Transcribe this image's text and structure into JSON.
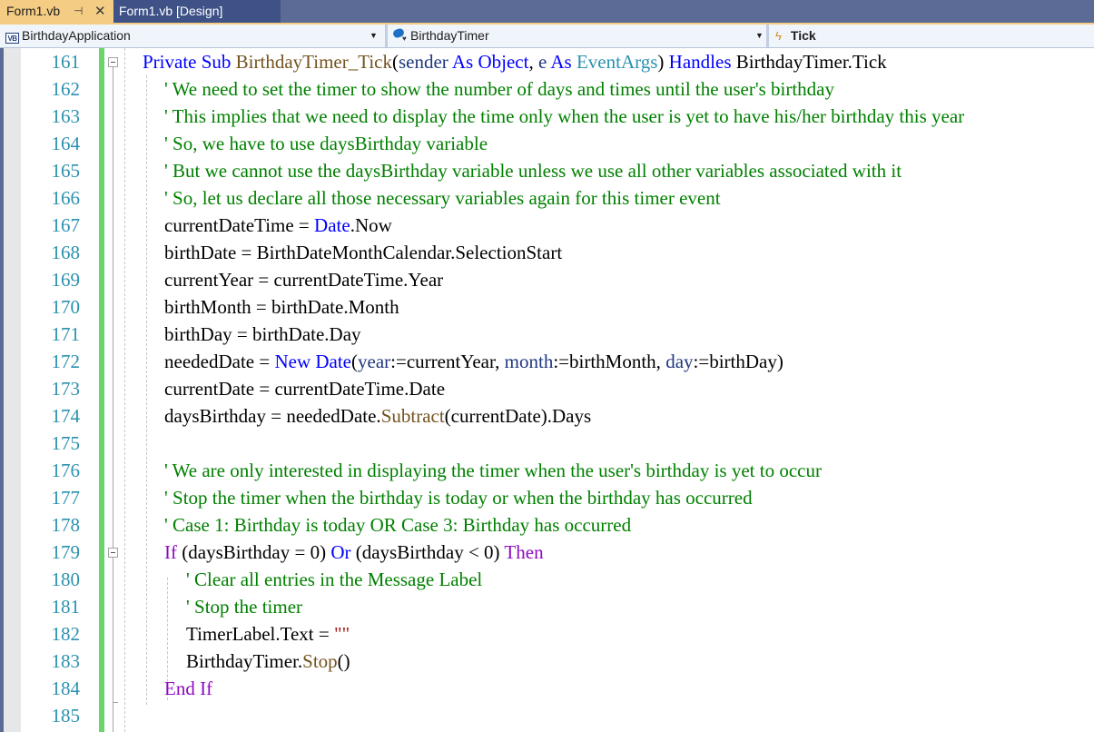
{
  "tabs": [
    {
      "label": "Form1.vb",
      "active": true,
      "pin_icon": "pin-icon",
      "close_icon": "close-icon"
    },
    {
      "label": "Form1.vb [Design]",
      "active": false
    }
  ],
  "navbar": {
    "project": {
      "icon": "vb-project-icon",
      "icon_text": "VB",
      "label": "BirthdayApplication"
    },
    "object": {
      "icon": "timer-component-icon",
      "label": "BirthdayTimer"
    },
    "event": {
      "icon": "lightning-event-icon",
      "label": "Tick"
    }
  },
  "colors": {
    "keyword": "#0000ff",
    "control_keyword": "#8f08c4",
    "comment": "#008000",
    "method": "#74531f",
    "type": "#2b91af",
    "parameter": "#1f377f",
    "string": "#a31515",
    "line_number": "#2b91af",
    "change_bar": "#6bd46b",
    "active_tab": "#f5cc84",
    "tab_strip": "#5c6b95"
  },
  "editor": {
    "line_numbers": [
      "161",
      "162",
      "163",
      "164",
      "165",
      "166",
      "167",
      "168",
      "169",
      "170",
      "171",
      "172",
      "173",
      "174",
      "175",
      "176",
      "177",
      "178",
      "179",
      "180",
      "181",
      "182",
      "183",
      "184",
      "185"
    ],
    "lines": [
      {
        "indent": 0,
        "tokens": [
          [
            "kw",
            "Private"
          ],
          [
            "",
            " "
          ],
          [
            "kw",
            "Sub"
          ],
          [
            "",
            " "
          ],
          [
            "fn",
            "BirthdayTimer_Tick"
          ],
          [
            "",
            "("
          ],
          [
            "pm",
            "sender"
          ],
          [
            "",
            " "
          ],
          [
            "kw",
            "As"
          ],
          [
            "",
            " "
          ],
          [
            "kw",
            "Object"
          ],
          [
            "",
            ", "
          ],
          [
            "pm",
            "e"
          ],
          [
            "",
            " "
          ],
          [
            "kw",
            "As"
          ],
          [
            "",
            " "
          ],
          [
            "ty",
            "EventArgs"
          ],
          [
            "",
            ") "
          ],
          [
            "kw",
            "Handles"
          ],
          [
            "",
            " BirthdayTimer.Tick"
          ]
        ]
      },
      {
        "indent": 1,
        "tokens": [
          [
            "cm",
            "' We need to set the timer to show the number of days and times until the user's birthday"
          ]
        ]
      },
      {
        "indent": 1,
        "tokens": [
          [
            "cm",
            "' This implies that we need to display the time only when the user is yet to have his/her birthday this year"
          ]
        ]
      },
      {
        "indent": 1,
        "tokens": [
          [
            "cm",
            "' So, we have to use daysBirthday variable"
          ]
        ]
      },
      {
        "indent": 1,
        "tokens": [
          [
            "cm",
            "' But we cannot use the daysBirthday variable unless we use all other variables associated with it"
          ]
        ]
      },
      {
        "indent": 1,
        "tokens": [
          [
            "cm",
            "' So, let us declare all those necessary variables again for this timer event"
          ]
        ]
      },
      {
        "indent": 1,
        "tokens": [
          [
            "",
            "currentDateTime = "
          ],
          [
            "kw",
            "Date"
          ],
          [
            "",
            ".Now"
          ]
        ]
      },
      {
        "indent": 1,
        "tokens": [
          [
            "",
            "birthDate = BirthDateMonthCalendar.SelectionStart"
          ]
        ]
      },
      {
        "indent": 1,
        "tokens": [
          [
            "",
            "currentYear = currentDateTime.Year"
          ]
        ]
      },
      {
        "indent": 1,
        "tokens": [
          [
            "",
            "birthMonth = birthDate.Month"
          ]
        ]
      },
      {
        "indent": 1,
        "tokens": [
          [
            "",
            "birthDay = birthDate.Day"
          ]
        ]
      },
      {
        "indent": 1,
        "tokens": [
          [
            "",
            "neededDate = "
          ],
          [
            "kw",
            "New"
          ],
          [
            "",
            " "
          ],
          [
            "kw",
            "Date"
          ],
          [
            "",
            "("
          ],
          [
            "pm",
            "year"
          ],
          [
            "",
            ":=currentYear, "
          ],
          [
            "pm",
            "month"
          ],
          [
            "",
            ":=birthMonth, "
          ],
          [
            "pm",
            "day"
          ],
          [
            "",
            ":=birthDay)"
          ]
        ]
      },
      {
        "indent": 1,
        "tokens": [
          [
            "",
            "currentDate = currentDateTime.Date"
          ]
        ]
      },
      {
        "indent": 1,
        "tokens": [
          [
            "",
            "daysBirthday = neededDate."
          ],
          [
            "fn",
            "Subtract"
          ],
          [
            "",
            "(currentDate).Days"
          ]
        ]
      },
      {
        "indent": 1,
        "tokens": []
      },
      {
        "indent": 1,
        "tokens": [
          [
            "cm",
            "' We are only interested in displaying the timer when the user's birthday is yet to occur"
          ]
        ]
      },
      {
        "indent": 1,
        "tokens": [
          [
            "cm",
            "' Stop the timer when the birthday is today or when the birthday has occurred"
          ]
        ]
      },
      {
        "indent": 1,
        "tokens": [
          [
            "cm",
            "' Case 1: Birthday is today OR Case 3: Birthday has occurred"
          ]
        ]
      },
      {
        "indent": 1,
        "tokens": [
          [
            "ctl",
            "If"
          ],
          [
            "",
            " (daysBirthday = 0) "
          ],
          [
            "kw",
            "Or"
          ],
          [
            "",
            " (daysBirthday < 0) "
          ],
          [
            "ctl",
            "Then"
          ]
        ]
      },
      {
        "indent": 2,
        "tokens": [
          [
            "cm",
            "' Clear all entries in the Message Label"
          ]
        ]
      },
      {
        "indent": 2,
        "tokens": [
          [
            "cm",
            "' Stop the timer"
          ]
        ]
      },
      {
        "indent": 2,
        "tokens": [
          [
            "",
            "TimerLabel.Text = "
          ],
          [
            "str",
            "\"\""
          ]
        ]
      },
      {
        "indent": 2,
        "tokens": [
          [
            "",
            "BirthdayTimer."
          ],
          [
            "fn",
            "Stop"
          ],
          [
            "",
            "()"
          ]
        ]
      },
      {
        "indent": 1,
        "tokens": [
          [
            "ctl",
            "End If"
          ]
        ]
      },
      {
        "indent": 1,
        "tokens": []
      }
    ]
  }
}
